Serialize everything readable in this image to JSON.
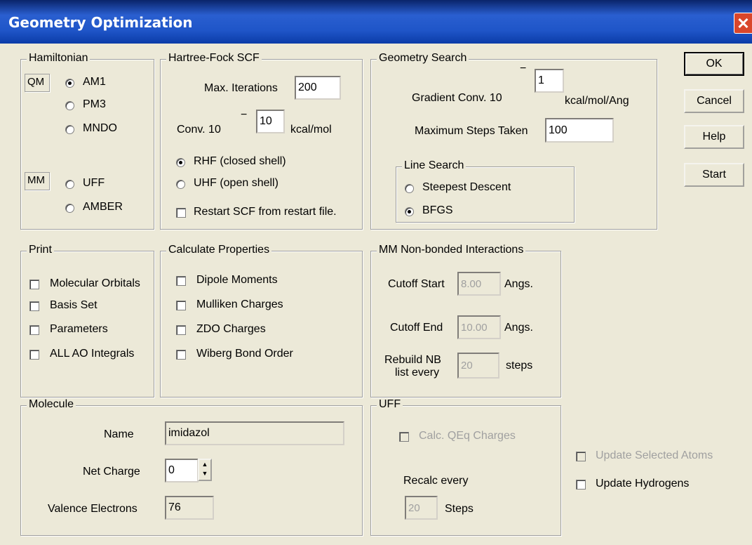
{
  "window": {
    "title": "Geometry Optimization",
    "close_glyph": "✕"
  },
  "buttons": {
    "ok": "OK",
    "cancel": "Cancel",
    "help": "Help",
    "start": "Start"
  },
  "hamiltonian": {
    "legend": "Hamiltonian",
    "qm_tag": "QM",
    "mm_tag": "MM",
    "options": {
      "am1": "AM1",
      "pm3": "PM3",
      "mndo": "MNDO",
      "uff": "UFF",
      "amber": "AMBER"
    },
    "selected": "AM1"
  },
  "hartree_fock": {
    "legend": "Hartree-Fock SCF",
    "max_iterations_label": "Max. Iterations",
    "max_iterations_value": "200",
    "conv_label": "Conv. 10",
    "conv_exp": "−",
    "conv_value": "10",
    "conv_unit": "kcal/mol",
    "rhf_label": "RHF (closed shell)",
    "uhf_label": "UHF (open shell)",
    "shell_selected": "RHF",
    "restart_label": "Restart SCF from restart file.",
    "restart_checked": false
  },
  "geometry_search": {
    "legend": "Geometry Search",
    "gradient_label": "Gradient Conv. 10",
    "gradient_exp": "−",
    "gradient_value": "1",
    "gradient_unit": "kcal/mol/Ang",
    "max_steps_label": "Maximum Steps Taken",
    "max_steps_value": "100",
    "line_search": {
      "legend": "Line Search",
      "steepest_label": "Steepest Descent",
      "bfgs_label": "BFGS",
      "selected": "BFGS"
    }
  },
  "print": {
    "legend": "Print",
    "items": [
      "Molecular Orbitals",
      "Basis Set",
      "Parameters",
      "ALL AO Integrals"
    ]
  },
  "calc_props": {
    "legend": "Calculate Properties",
    "items": [
      "Dipole Moments",
      "Mulliken Charges",
      "ZDO Charges",
      "Wiberg Bond Order"
    ]
  },
  "mm_nonbonded": {
    "legend": "MM Non-bonded Interactions",
    "cutoff_start_label": "Cutoff Start",
    "cutoff_start_value": "8.00",
    "cutoff_end_label": "Cutoff End",
    "cutoff_end_value": "10.00",
    "angs": "Angs.",
    "rebuild_label_1": "Rebuild NB",
    "rebuild_label_2": "list every",
    "rebuild_value": "20",
    "steps": "steps"
  },
  "molecule": {
    "legend": "Molecule",
    "name_label": "Name",
    "name_value": "imidazol",
    "net_charge_label": "Net Charge",
    "net_charge_value": "0",
    "valence_label": "Valence Electrons",
    "valence_value": "76"
  },
  "uff": {
    "legend": "UFF",
    "qeq_label": "Calc. QEq Charges",
    "recalc_label": "Recalc every",
    "recalc_value": "20",
    "steps_label": "Steps"
  },
  "update": {
    "selected_atoms_label": "Update Selected Atoms",
    "hydrogens_label": "Update Hydrogens"
  }
}
